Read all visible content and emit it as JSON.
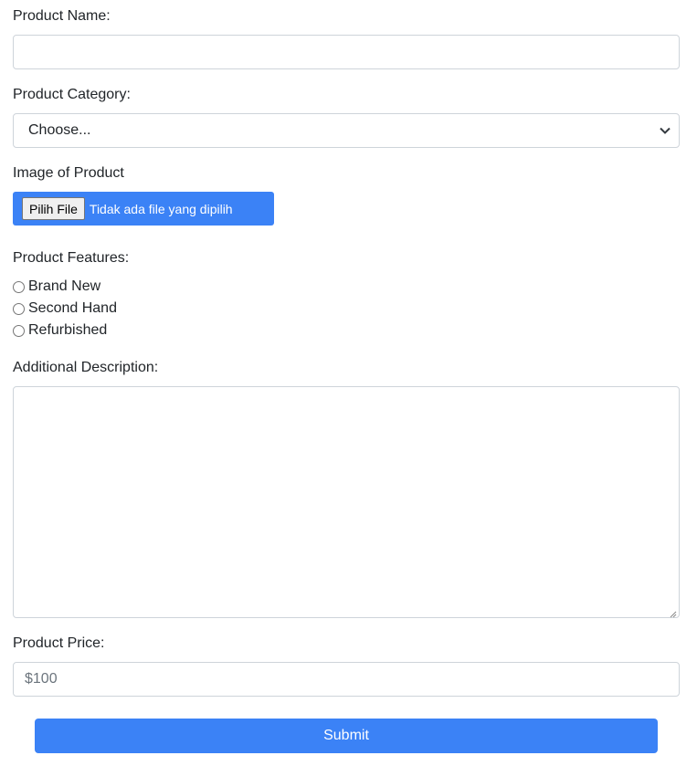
{
  "form": {
    "product_name": {
      "label": "Product Name:",
      "value": ""
    },
    "product_category": {
      "label": "Product Category:",
      "selected": "Choose...",
      "icon": "chevron-down-icon"
    },
    "image": {
      "label": "Image of Product",
      "button_label": "Pilih File",
      "status": "Tidak ada file yang dipilih",
      "accent": "#3b82f6"
    },
    "features": {
      "label": "Product Features:",
      "options": [
        "Brand New",
        "Second Hand",
        "Refurbished"
      ]
    },
    "description": {
      "label": "Additional Description:",
      "value": ""
    },
    "price": {
      "label": "Product Price:",
      "placeholder": "$100"
    },
    "submit": {
      "label": "Submit",
      "color": "#3b82f6"
    }
  }
}
